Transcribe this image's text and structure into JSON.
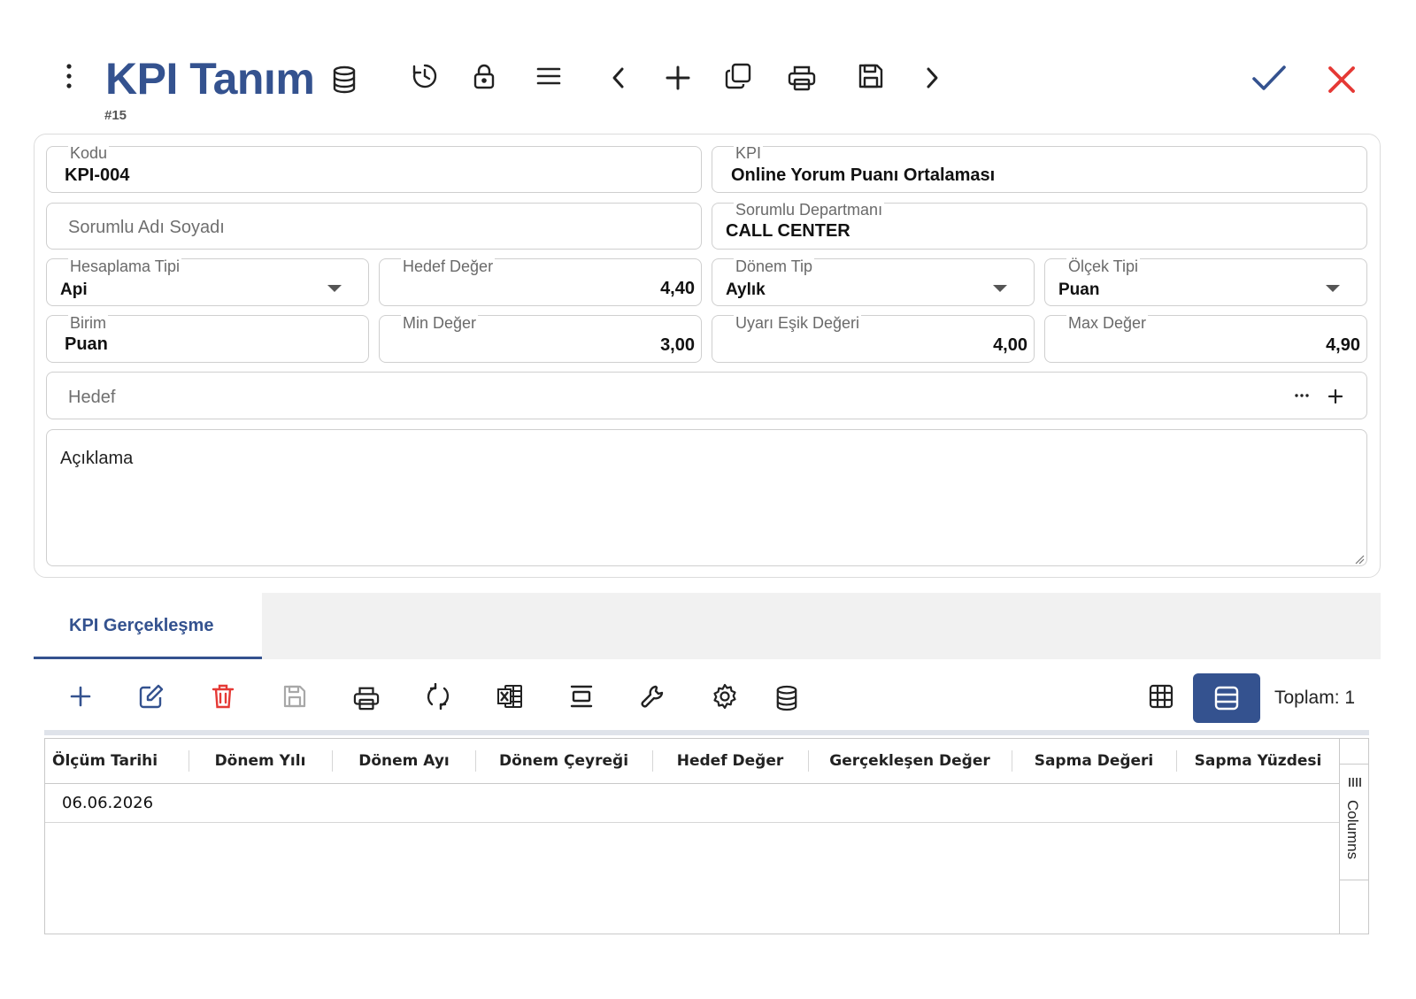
{
  "header": {
    "title": "KPI Tanım",
    "record_id": "#15"
  },
  "icons": {
    "menu": "vertical-dots-icon",
    "database": "database-icon",
    "history": "history-icon",
    "lock": "lock-icon",
    "list": "hamburger-menu-icon",
    "previous": "chevron-left-icon",
    "add": "plus-icon",
    "copy": "copy-icon",
    "print": "printer-icon",
    "save": "save-icon",
    "next": "chevron-right-icon",
    "confirm": "checkmark-icon",
    "close": "close-icon"
  },
  "colors": {
    "brand": "#34528f",
    "confirm": "#34528f",
    "close": "#e53935",
    "delete": "#e53935"
  },
  "form": {
    "code": {
      "label": "Kodu",
      "value": "KPI-004"
    },
    "kpi": {
      "label": "KPI",
      "value": "Online Yorum Puanı Ortalaması"
    },
    "responsible_name": {
      "placeholder": "Sorumlu Adı Soyadı"
    },
    "responsible_department": {
      "label": "Sorumlu Departmanı",
      "value": "CALL CENTER"
    },
    "calculation_type": {
      "label": "Hesaplama Tipi",
      "value": "Api"
    },
    "target_value": {
      "label": "Hedef Değer",
      "value": "4,40"
    },
    "period_type": {
      "label": "Dönem Tip",
      "value": "Aylık"
    },
    "scale_type": {
      "label": "Ölçek Tipi",
      "value": "Puan"
    },
    "unit": {
      "label": "Birim",
      "value": "Puan"
    },
    "min_value": {
      "label": "Min Değer",
      "value": "3,00"
    },
    "warning_threshold": {
      "label": "Uyarı Eşik Değeri",
      "value": "4,00"
    },
    "max_value": {
      "label": "Max Değer",
      "value": "4,90"
    },
    "goal": {
      "placeholder": "Hedef"
    },
    "description": {
      "placeholder": "Açıklama"
    }
  },
  "tabs": [
    {
      "label": "KPI Gerçekleşme",
      "active": true
    }
  ],
  "grid_toolbar": {
    "total_label": "Toplam: 1"
  },
  "grid": {
    "columns": [
      "Ölçüm Tarihi",
      "Dönem Yılı",
      "Dönem Ayı",
      "Dönem Çeyreği",
      "Hedef Değer",
      "Gerçekleşen Değer",
      "Sapma Değeri",
      "Sapma Yüzdesi"
    ],
    "rows": [
      {
        "measurement_date": "06.06.2026"
      }
    ],
    "side_panel_label": "Columns"
  }
}
